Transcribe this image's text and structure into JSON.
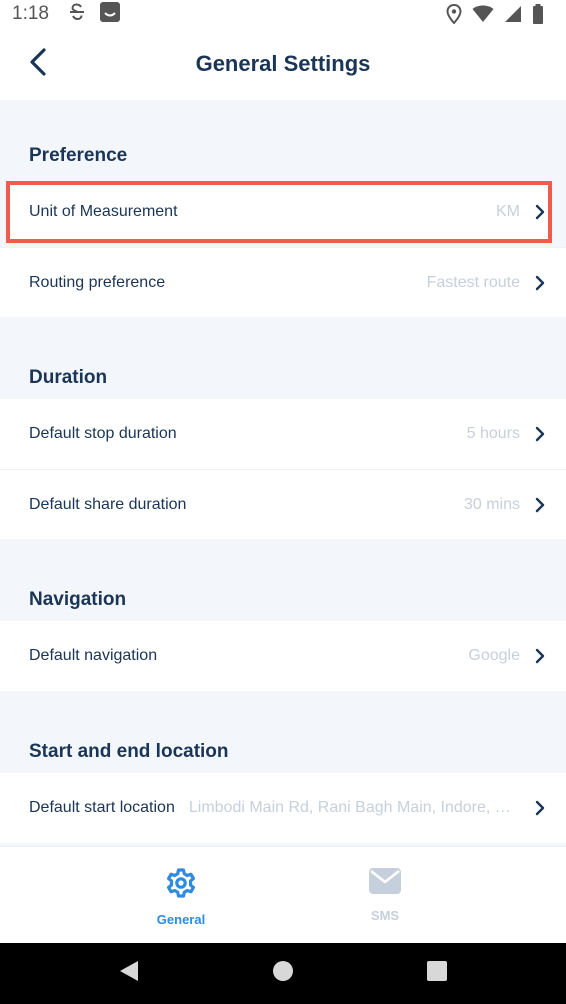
{
  "status_bar": {
    "time": "1:18"
  },
  "header": {
    "title": "General Settings"
  },
  "sections": [
    {
      "title": "Preference",
      "rows": [
        {
          "label": "Unit of Measurement",
          "value": "KM"
        },
        {
          "label": "Routing preference",
          "value": "Fastest route"
        }
      ]
    },
    {
      "title": "Duration",
      "rows": [
        {
          "label": "Default stop duration",
          "value": "5 hours"
        },
        {
          "label": "Default share duration",
          "value": "30 mins"
        }
      ]
    },
    {
      "title": "Navigation",
      "rows": [
        {
          "label": "Default navigation",
          "value": "Google"
        }
      ]
    },
    {
      "title": "Start and end location",
      "rows": [
        {
          "label": "Default start location",
          "value": "Limbodi Main Rd, Rani Bagh Main, Indore, Madhya Pradesh"
        }
      ]
    }
  ],
  "bottom_nav": {
    "general_label": "General",
    "sms_label": "SMS"
  },
  "colors": {
    "accent": "#2f8be0",
    "title": "#1a3556",
    "muted": "#c6d0dc",
    "highlight": "#ef5b4c",
    "background": "#f3f7fc"
  }
}
